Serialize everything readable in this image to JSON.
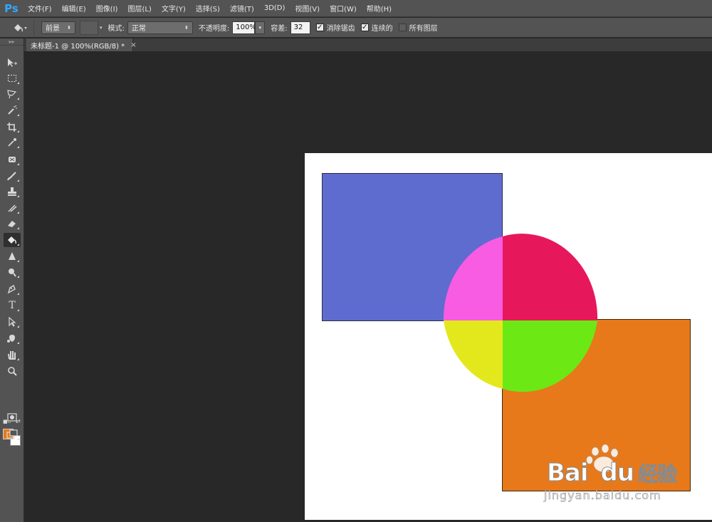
{
  "app": {
    "logo": "Ps"
  },
  "menu": {
    "items": [
      "文件(F)",
      "编辑(E)",
      "图像(I)",
      "图层(L)",
      "文字(Y)",
      "选择(S)",
      "滤镜(T)",
      "3D(D)",
      "视图(V)",
      "窗口(W)",
      "帮助(H)"
    ]
  },
  "options": {
    "tool_icon": "paint-bucket-icon",
    "fill_source": "前景",
    "mode_label": "模式:",
    "mode_value": "正常",
    "opacity_label": "不透明度:",
    "opacity_value": "100%",
    "tolerance_label": "容差:",
    "tolerance_value": "32",
    "antialias_label": "消除锯齿",
    "antialias_checked": true,
    "contiguous_label": "连续的",
    "contiguous_checked": true,
    "all_layers_label": "所有图层",
    "all_layers_checked": false
  },
  "document": {
    "tab_title": "未标题-1 @ 100%(RGB/8) *",
    "close_symbol": "×"
  },
  "tools": [
    "move-tool-icon",
    "marquee-tool-icon",
    "lasso-tool-icon",
    "magic-wand-tool-icon",
    "crop-tool-icon",
    "eyedropper-tool-icon",
    "healing-brush-tool-icon",
    "brush-tool-icon",
    "clone-stamp-tool-icon",
    "history-brush-tool-icon",
    "eraser-tool-icon",
    "paint-bucket-tool-icon",
    "blur-tool-icon",
    "dodge-tool-icon",
    "pen-tool-icon",
    "type-tool-icon",
    "path-selection-tool-icon",
    "custom-shape-tool-icon",
    "hand-tool-icon",
    "zoom-tool-icon",
    "quick-mask-icon",
    "screen-mode-icon"
  ],
  "type_tool_glyph": "T",
  "colors": {
    "foreground": "#e67a1b",
    "background": "#ffffff",
    "blue_rect": "#5e6ccf",
    "orange_rect": "#e7791b",
    "circle_top_right": "#e6185b",
    "circle_top_left": "#f75ce2",
    "circle_bottom_left": "#e3e81c",
    "circle_bottom_right": "#6ce814"
  },
  "watermark": {
    "brand": "Bai",
    "brand_du": "du",
    "brand_cn": "经验",
    "url": "jingyan.baidu.com"
  }
}
